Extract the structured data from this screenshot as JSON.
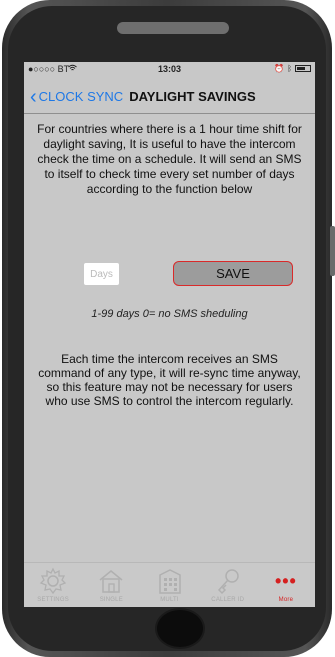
{
  "status_bar": {
    "carrier": "●○○○○ BT",
    "time": "13:03"
  },
  "nav": {
    "back_label": "CLOCK SYNC",
    "title": "DAYLIGHT SAVINGS"
  },
  "intro_text": "For countries where there is a 1 hour time shift for daylight saving, It is useful to have the intercom check the time on a schedule. It will send an SMS to itself to check time every set number of days according to the function below",
  "days_input": {
    "placeholder": "Days",
    "value": ""
  },
  "save_label": "SAVE",
  "hint_text": "1-99 days   0= no SMS sheduling",
  "note_text": "Each time the intercom receives an SMS command of any type, it will re-sync time anyway, so this feature may not be necessary for users who use SMS to control the intercom regularly.",
  "tabs": [
    {
      "label": "SETTINGS",
      "icon": "gear-icon"
    },
    {
      "label": "SINGLE",
      "icon": "house-icon"
    },
    {
      "label": "MULTI",
      "icon": "building-icon"
    },
    {
      "label": "CALLER ID",
      "icon": "key-icon"
    },
    {
      "label": "More",
      "icon": "more-dots-icon",
      "active": true
    }
  ],
  "colors": {
    "accent": "#1e78e6",
    "active_tab": "#d52020",
    "screen_bg": "#c8c8c8",
    "save_border": "#d92a2a"
  }
}
